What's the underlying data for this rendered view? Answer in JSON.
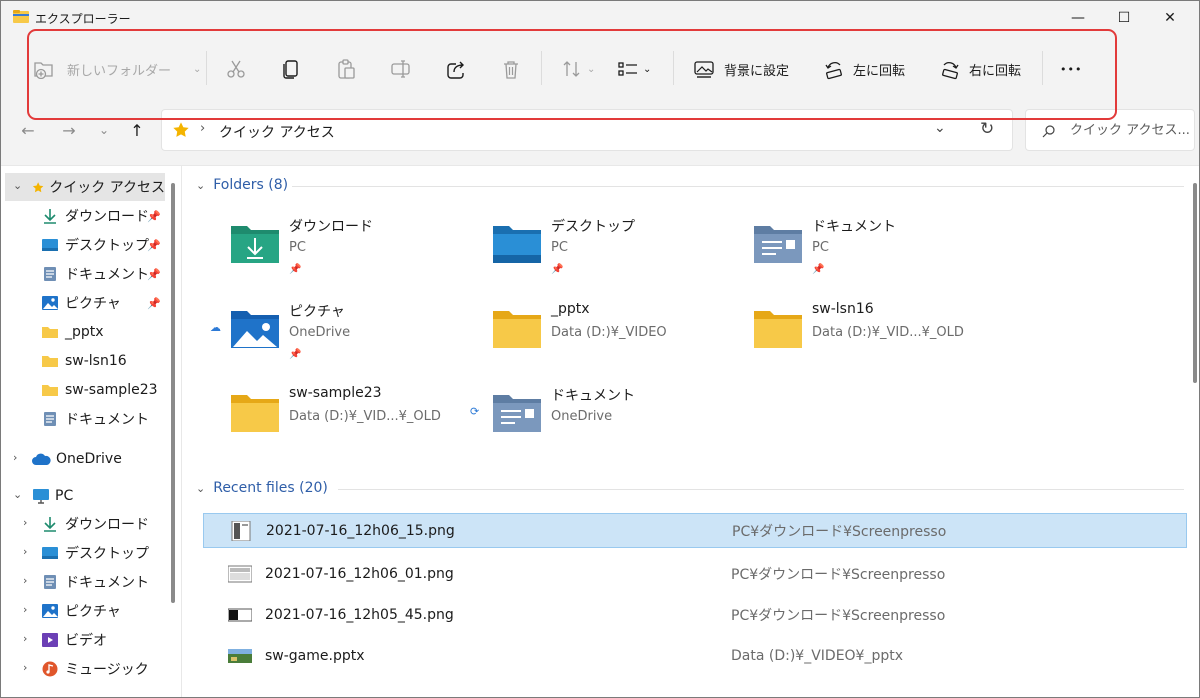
{
  "window": {
    "title": "エクスプローラー",
    "minimize_label": "—",
    "maximize_label": "☐",
    "close_label": "✕"
  },
  "toolbar": {
    "new_folder_label": "新しいフォルダー",
    "set_background_label": "背景に設定",
    "rotate_left_label": "左に回転",
    "rotate_right_label": "右に回転",
    "more_label": "•••",
    "icons": [
      "new-folder-icon",
      "cut-icon",
      "copy-icon",
      "paste-icon",
      "rename-icon",
      "share-icon",
      "delete-icon",
      "sort-icon",
      "view-icon",
      "set-background-icon",
      "rotate-left-icon",
      "rotate-right-icon",
      "more-icon"
    ]
  },
  "nav": {
    "back": "←",
    "forward": "→",
    "recent": "⌄",
    "up": "↑"
  },
  "address": {
    "separator": "›",
    "crumb": "クイック アクセス",
    "dropdown": "⌄",
    "refresh": "↻"
  },
  "search": {
    "placeholder": "クイック アクセス..."
  },
  "sidebar": {
    "quick_access": "クイック アクセス",
    "quick_items": [
      {
        "label": "ダウンロード",
        "pinned": true
      },
      {
        "label": "デスクトップ",
        "pinned": true
      },
      {
        "label": "ドキュメント",
        "pinned": true
      },
      {
        "label": "ピクチャ",
        "pinned": true
      },
      {
        "label": "_pptx",
        "pinned": false
      },
      {
        "label": "sw-lsn16",
        "pinned": false
      },
      {
        "label": "sw-sample23",
        "pinned": false
      },
      {
        "label": "ドキュメント",
        "pinned": false
      }
    ],
    "onedrive": "OneDrive",
    "pc": "PC",
    "pc_items": [
      {
        "label": "ダウンロード"
      },
      {
        "label": "デスクトップ"
      },
      {
        "label": "ドキュメント"
      },
      {
        "label": "ピクチャ"
      },
      {
        "label": "ビデオ"
      },
      {
        "label": "ミュージック"
      }
    ]
  },
  "folders_section": {
    "title": "Folders (8)",
    "items": [
      {
        "name": "ダウンロード",
        "location": "PC",
        "pinned": true
      },
      {
        "name": "デスクトップ",
        "location": "PC",
        "pinned": true
      },
      {
        "name": "ドキュメント",
        "location": "PC",
        "pinned": true
      },
      {
        "name": "ピクチャ",
        "location": "OneDrive",
        "pinned": true
      },
      {
        "name": "_pptx",
        "location": "Data (D:)¥_VIDEO",
        "pinned": false
      },
      {
        "name": "sw-lsn16",
        "location": "Data (D:)¥_VID...¥_OLD",
        "pinned": false
      },
      {
        "name": "sw-sample23",
        "location": "Data (D:)¥_VID...¥_OLD",
        "pinned": false
      },
      {
        "name": "ドキュメント",
        "location": "OneDrive",
        "pinned": false
      }
    ]
  },
  "recent_section": {
    "title": "Recent files (20)",
    "files": [
      {
        "name": "2021-07-16_12h06_15.png",
        "path": "PC¥ダウンロード¥Screenpresso"
      },
      {
        "name": "2021-07-16_12h06_01.png",
        "path": "PC¥ダウンロード¥Screenpresso"
      },
      {
        "name": "2021-07-16_12h05_45.png",
        "path": "PC¥ダウンロード¥Screenpresso"
      },
      {
        "name": "sw-game.pptx",
        "path": "Data (D:)¥_VIDEO¥_pptx"
      }
    ]
  },
  "colors": {
    "accent": "#2d7ad6",
    "selection": "#cce4f7",
    "highlight_outline": "#e23a3a",
    "folder_yellow": "#f7c948"
  }
}
